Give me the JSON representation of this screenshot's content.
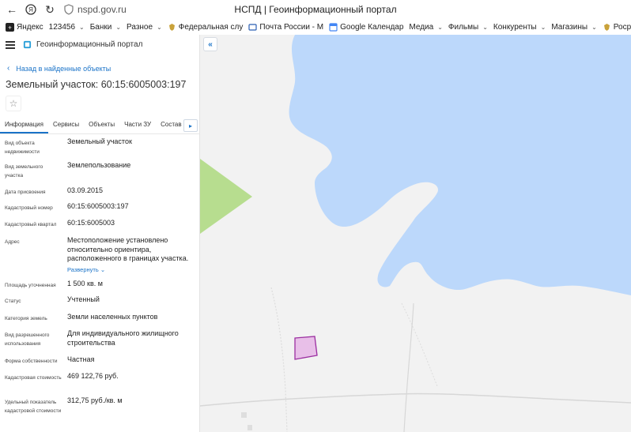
{
  "browser": {
    "url": "nspd.gov.ru",
    "title": "НСПД | Геоинформационный портал"
  },
  "bookmarks": [
    {
      "label": "Яндекс",
      "icon": "yandex-icon",
      "chevron": false
    },
    {
      "label": "123456",
      "icon": "",
      "chevron": true
    },
    {
      "label": "Банки",
      "icon": "",
      "chevron": true
    },
    {
      "label": "Разное",
      "icon": "",
      "chevron": true
    },
    {
      "label": "Федеральная слу",
      "icon": "emblem-icon",
      "chevron": false
    },
    {
      "label": "Почта России - М",
      "icon": "post-icon",
      "chevron": false
    },
    {
      "label": "Google Календар",
      "icon": "calendar-icon",
      "chevron": false
    },
    {
      "label": "Медиа",
      "icon": "",
      "chevron": true
    },
    {
      "label": "Фильмы",
      "icon": "",
      "chevron": true
    },
    {
      "label": "Конкуренты",
      "icon": "",
      "chevron": true
    },
    {
      "label": "Магазины",
      "icon": "",
      "chevron": true
    },
    {
      "label": "Росреестр",
      "icon": "emblem-icon",
      "chevron": false
    }
  ],
  "app": {
    "title": "Геоинформационный портал",
    "back_link": "Назад в найденные объекты",
    "object_title": "Земельный участок: 60:15:6005003:197",
    "expand_link": "Развернуть"
  },
  "tabs": [
    {
      "label": "Информация",
      "active": true
    },
    {
      "label": "Сервисы",
      "active": false
    },
    {
      "label": "Объекты",
      "active": false
    },
    {
      "label": "Части ЗУ",
      "active": false
    },
    {
      "label": "Состав",
      "active": false
    }
  ],
  "properties": [
    {
      "label": "Вид объекта недвижимости",
      "value": "Земельный участок"
    },
    {
      "label": "Вид земельного участка",
      "value": "Землепользование"
    },
    {
      "label": "Дата присвоения",
      "value": "03.09.2015"
    },
    {
      "label": "Кадастровый номер",
      "value": "60:15:6005003:197"
    },
    {
      "label": "Кадастровый квартал",
      "value": "60:15:6005003"
    },
    {
      "label": "Адрес",
      "value": "Местоположение установлено относительно ориентира, расположенного в границах участка."
    },
    {
      "label": "Площадь уточненная",
      "value": "1 500 кв. м"
    },
    {
      "label": "Статус",
      "value": "Учтенный"
    },
    {
      "label": "Категория земель",
      "value": "Земли населенных пунктов"
    },
    {
      "label": "Вид разрешенного использования",
      "value": "Для индивидуального жилищного строительства"
    },
    {
      "label": "Форма собственности",
      "value": "Частная"
    },
    {
      "label": "Кадастровая стоимость",
      "value": "469 122,76 руб."
    },
    {
      "label": "Удельный показатель кадастровой стоимости",
      "value": "312,75 руб./кв. м"
    }
  ],
  "colors": {
    "accent": "#1a73c8",
    "water": "#bcd8fb",
    "land": "#f2f2f2",
    "green_area": "#b7dd8f",
    "parcel_fill": "#e8bfe8",
    "parcel_stroke": "#9b2fa0"
  }
}
